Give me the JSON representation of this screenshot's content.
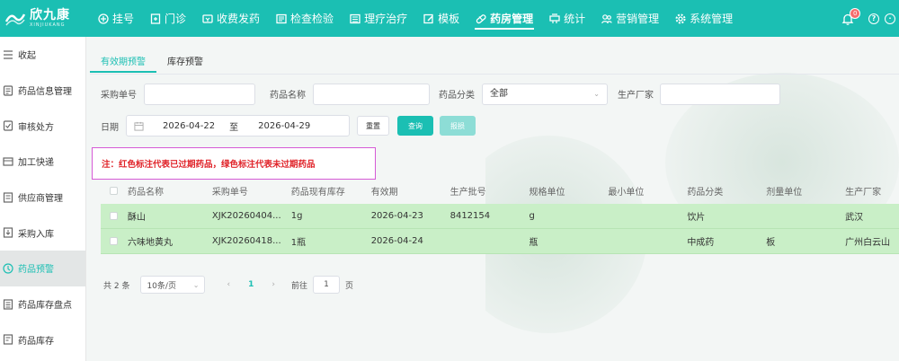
{
  "brand": {
    "name": "欣九康",
    "sub": "XINJIUKANG",
    "color": "#1bbfb3"
  },
  "nav": [
    {
      "label": "挂号",
      "icon": "plus-icon"
    },
    {
      "label": "门诊",
      "icon": "clinic-icon"
    },
    {
      "label": "收费发药",
      "icon": "charge-icon"
    },
    {
      "label": "检查检验",
      "icon": "exam-icon"
    },
    {
      "label": "理疗治疗",
      "icon": "therapy-icon"
    },
    {
      "label": "模板",
      "icon": "template-icon"
    },
    {
      "label": "药房管理",
      "icon": "pharmacy-icon",
      "active": true
    },
    {
      "label": "统计",
      "icon": "chart-icon"
    },
    {
      "label": "营销管理",
      "icon": "marketing-icon"
    },
    {
      "label": "系统管理",
      "icon": "settings-icon"
    }
  ],
  "top_right": {
    "notification_count": "0"
  },
  "sidebar": [
    {
      "label": "收起",
      "icon": "collapse-icon"
    },
    {
      "label": "药品信息管理",
      "icon": "drug-info-icon"
    },
    {
      "label": "审核处方",
      "icon": "audit-icon"
    },
    {
      "label": "加工快递",
      "icon": "process-icon"
    },
    {
      "label": "供应商管理",
      "icon": "supplier-icon"
    },
    {
      "label": "采购入库",
      "icon": "purchase-icon"
    },
    {
      "label": "药品预警",
      "icon": "warning-icon",
      "active": true
    },
    {
      "label": "药品库存盘点",
      "icon": "inventory-check-icon"
    },
    {
      "label": "药品库存",
      "icon": "stock-icon"
    }
  ],
  "tabs": [
    {
      "label": "有效期预警",
      "active": true
    },
    {
      "label": "库存预警"
    }
  ],
  "filters": {
    "purchase_no_label": "采购单号",
    "drug_name_label": "药品名称",
    "category_label": "药品分类",
    "category_value": "全部",
    "manufacturer_label": "生产厂家",
    "date_label": "日期",
    "date_from": "2026-04-22",
    "date_sep": "至",
    "date_to": "2026-04-29",
    "reset_label": "重置",
    "query_label": "查询",
    "report_label": "报损"
  },
  "note": "注：红色标注代表已过期药品，绿色标注代表未过期药品",
  "table": {
    "columns": [
      "药品名称",
      "采购单号",
      "药品现有库存",
      "有效期",
      "生产批号",
      "规格单位",
      "最小单位",
      "药品分类",
      "剂量单位",
      "生产厂家"
    ],
    "rows": [
      [
        "酥山",
        "XJK20260404...",
        "1g",
        "2026-04-23",
        "8412154",
        "g",
        "",
        "饮片",
        "",
        "武汉"
      ],
      [
        "六味地黄丸",
        "XJK20260418...",
        "1瓶",
        "2026-04-24",
        "",
        "瓶",
        "",
        "中成药",
        "板",
        "广州白云山"
      ]
    ],
    "row_color": "#c9efc7"
  },
  "pager": {
    "total": "共 2 条",
    "page_size": "10条/页",
    "current": "1",
    "goto_label": "前往",
    "goto_value": "1",
    "page_unit": "页"
  }
}
